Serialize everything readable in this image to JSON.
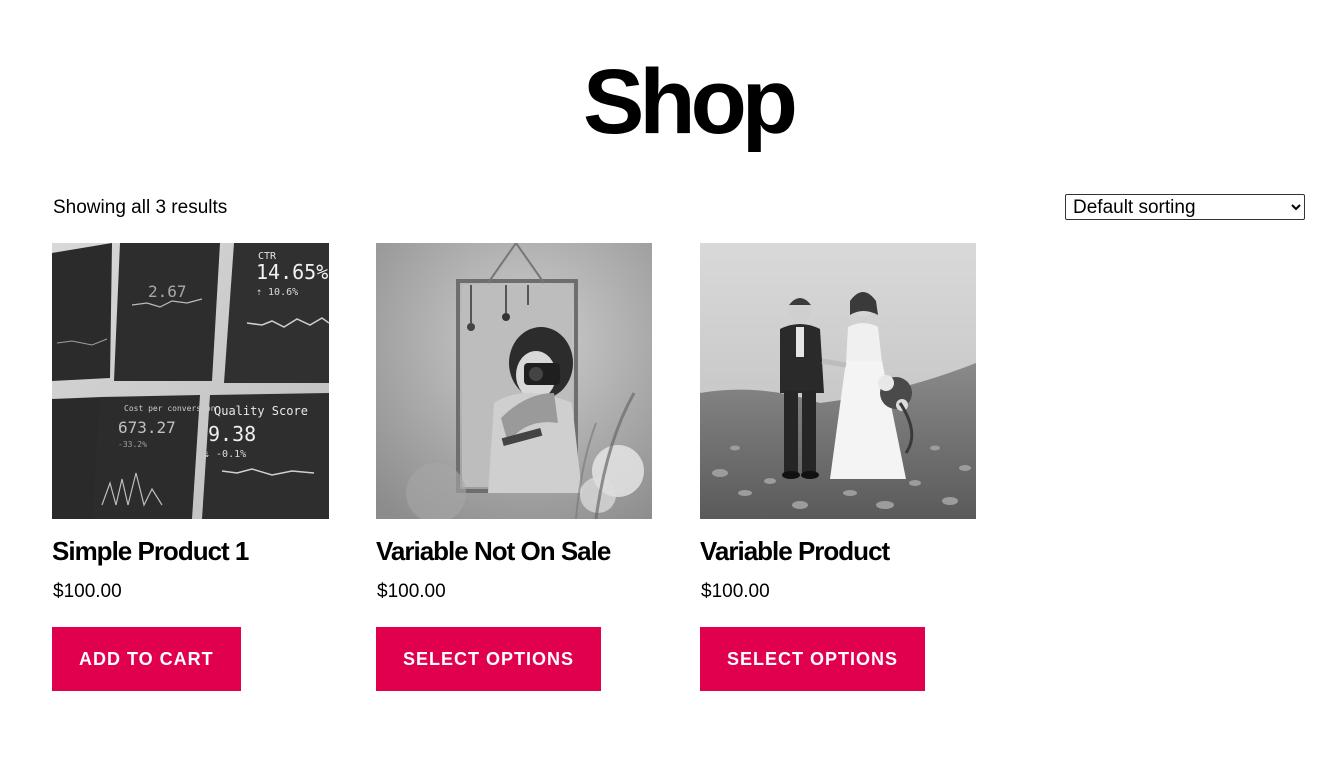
{
  "page": {
    "title": "Shop",
    "result_count": "Showing all 3 results"
  },
  "sorting": {
    "selected": "Default sorting",
    "options": [
      "Default sorting"
    ]
  },
  "colors": {
    "button_bg": "#e0004d",
    "button_text": "#ffffff",
    "text": "#000000",
    "background": "#ffffff"
  },
  "products": [
    {
      "name": "Simple Product 1",
      "price": "$100.00",
      "button_label": "ADD TO CART",
      "image": "analytics-dashboard-photo",
      "image_texts": {
        "ctr_label": "CTR",
        "ctr_value": "14.65%",
        "ctr_change": "⇡ 10.6%",
        "cpc_label": "Cost per conversion",
        "cpc_value": "673.27",
        "cpc_change": "-33.2%",
        "qs_label": "Quality Score",
        "qs_value": "9.38",
        "qs_change": "⇣ -0.1%",
        "misc_value": "2.67"
      }
    },
    {
      "name": "Variable Not On Sale",
      "price": "$100.00",
      "button_label": "SELECT OPTIONS",
      "image": "woman-with-camera-photo"
    },
    {
      "name": "Variable Product",
      "price": "$100.00",
      "button_label": "SELECT OPTIONS",
      "image": "wedding-couple-photo"
    }
  ]
}
